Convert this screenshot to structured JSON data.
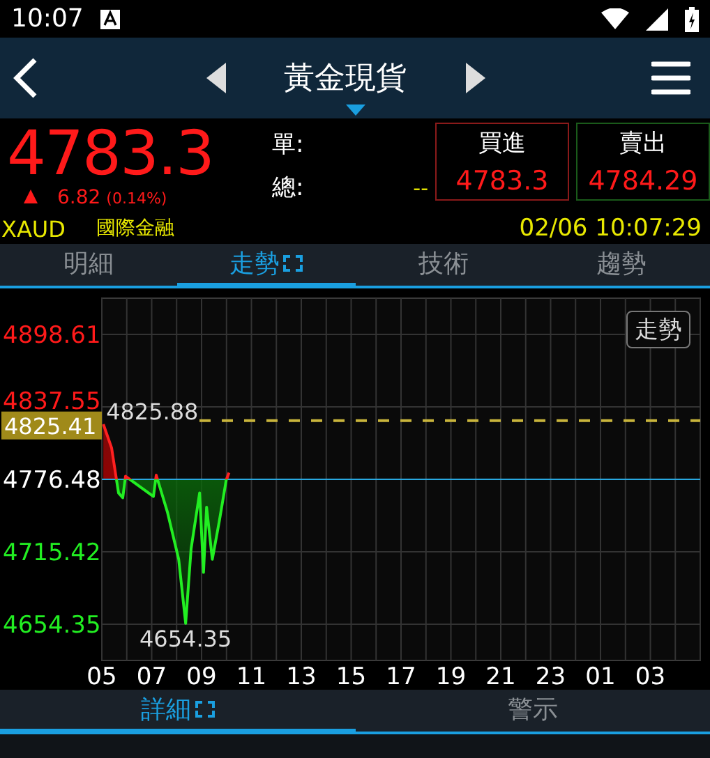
{
  "status_bar": {
    "time": "10:07"
  },
  "header": {
    "title": "黃金現貨"
  },
  "quote": {
    "price": "4783.3",
    "up": true,
    "change": "6.82",
    "change_pct": "(0.14%)",
    "fields": [
      {
        "label": "單:"
      },
      {
        "label": "總:",
        "value": "--"
      }
    ],
    "bid": {
      "label": "買進",
      "value": "4783.3"
    },
    "ask": {
      "label": "賣出",
      "value": "4784.29"
    }
  },
  "info": {
    "symbol": "XAUD",
    "source": "國際金融",
    "datetime": "02/06 10:07:29"
  },
  "tabs": [
    {
      "label": "明細",
      "selected": false
    },
    {
      "label": "走勢",
      "selected": true
    },
    {
      "label": "技術",
      "selected": false
    },
    {
      "label": "趨勢",
      "selected": false
    }
  ],
  "chart": {
    "mode_button": "走勢",
    "open_tag": "4825.41",
    "next_day_labels": [
      "01",
      "03"
    ],
    "chart_data": {
      "type": "area",
      "grid": true,
      "xlim": [
        5,
        29
      ],
      "ylim": [
        4623.8,
        4929.1
      ],
      "xticks": [
        {
          "value": 5,
          "label": "05"
        },
        {
          "value": 7,
          "label": "07"
        },
        {
          "value": 9,
          "label": "09"
        },
        {
          "value": 11,
          "label": "11"
        },
        {
          "value": 13,
          "label": "13"
        },
        {
          "value": 15,
          "label": "15"
        },
        {
          "value": 17,
          "label": "17"
        },
        {
          "value": 19,
          "label": "19"
        },
        {
          "value": 21,
          "label": "21"
        },
        {
          "value": 23,
          "label": "23"
        }
      ],
      "yticks": [
        {
          "value": 4898.61,
          "label": "4898.61"
        },
        {
          "value": 4837.55,
          "label": "4837.55"
        },
        {
          "value": 4776.48,
          "label": "4776.48"
        },
        {
          "value": 4715.42,
          "label": "4715.42"
        },
        {
          "value": 4654.35,
          "label": "4654.35"
        }
      ],
      "x": [
        5.06,
        5.39,
        5.56,
        5.67,
        5.84,
        5.95,
        7.07,
        7.18,
        7.63,
        8.08,
        8.36,
        8.58,
        8.92,
        9.08,
        9.2,
        9.43,
        9.71,
        9.99,
        10.1
      ],
      "series": [
        {
          "color": "#22ee22",
          "values": [
            4823,
            4803,
            4780,
            4765,
            4761,
            4779,
            4762,
            4780,
            4749,
            4709,
            4655,
            4718,
            4765,
            4698,
            4753,
            4709,
            4741,
            4776,
            4782
          ]
        }
      ],
      "ref_lines": [
        {
          "axis": "y",
          "value": 4776.48,
          "color": "#29a8e0"
        },
        {
          "axis": "y",
          "value": 4825.88,
          "color": "#c8b43c"
        }
      ],
      "annotations": [
        {
          "text": "4825.88",
          "x": 5.06,
          "y": 4825.88
        },
        {
          "text": "4654.35",
          "x": 8.36,
          "y": 4654.35
        }
      ]
    }
  },
  "bottom_tabs": [
    {
      "label": "詳細",
      "selected": true
    },
    {
      "label": "警示",
      "selected": false
    }
  ]
}
